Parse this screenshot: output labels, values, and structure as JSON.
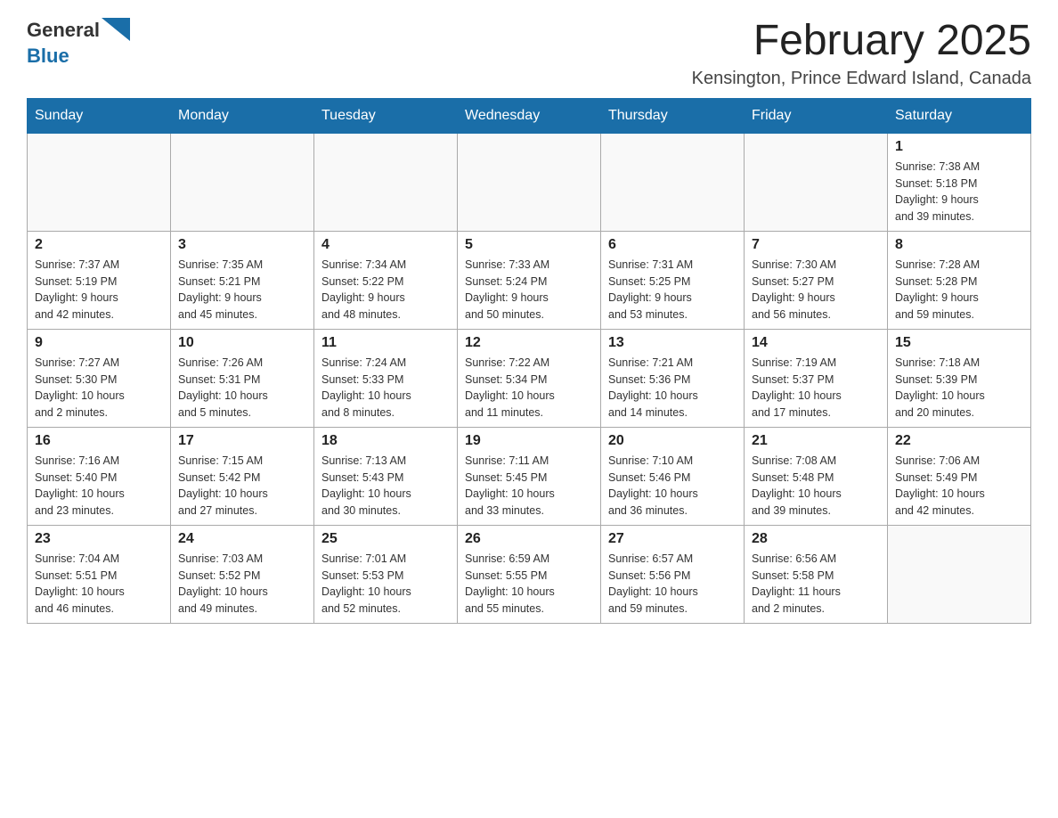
{
  "header": {
    "logo_general": "General",
    "logo_blue": "Blue",
    "month_title": "February 2025",
    "location": "Kensington, Prince Edward Island, Canada"
  },
  "days_of_week": [
    "Sunday",
    "Monday",
    "Tuesday",
    "Wednesday",
    "Thursday",
    "Friday",
    "Saturday"
  ],
  "weeks": [
    [
      {
        "day": "",
        "info": ""
      },
      {
        "day": "",
        "info": ""
      },
      {
        "day": "",
        "info": ""
      },
      {
        "day": "",
        "info": ""
      },
      {
        "day": "",
        "info": ""
      },
      {
        "day": "",
        "info": ""
      },
      {
        "day": "1",
        "info": "Sunrise: 7:38 AM\nSunset: 5:18 PM\nDaylight: 9 hours\nand 39 minutes."
      }
    ],
    [
      {
        "day": "2",
        "info": "Sunrise: 7:37 AM\nSunset: 5:19 PM\nDaylight: 9 hours\nand 42 minutes."
      },
      {
        "day": "3",
        "info": "Sunrise: 7:35 AM\nSunset: 5:21 PM\nDaylight: 9 hours\nand 45 minutes."
      },
      {
        "day": "4",
        "info": "Sunrise: 7:34 AM\nSunset: 5:22 PM\nDaylight: 9 hours\nand 48 minutes."
      },
      {
        "day": "5",
        "info": "Sunrise: 7:33 AM\nSunset: 5:24 PM\nDaylight: 9 hours\nand 50 minutes."
      },
      {
        "day": "6",
        "info": "Sunrise: 7:31 AM\nSunset: 5:25 PM\nDaylight: 9 hours\nand 53 minutes."
      },
      {
        "day": "7",
        "info": "Sunrise: 7:30 AM\nSunset: 5:27 PM\nDaylight: 9 hours\nand 56 minutes."
      },
      {
        "day": "8",
        "info": "Sunrise: 7:28 AM\nSunset: 5:28 PM\nDaylight: 9 hours\nand 59 minutes."
      }
    ],
    [
      {
        "day": "9",
        "info": "Sunrise: 7:27 AM\nSunset: 5:30 PM\nDaylight: 10 hours\nand 2 minutes."
      },
      {
        "day": "10",
        "info": "Sunrise: 7:26 AM\nSunset: 5:31 PM\nDaylight: 10 hours\nand 5 minutes."
      },
      {
        "day": "11",
        "info": "Sunrise: 7:24 AM\nSunset: 5:33 PM\nDaylight: 10 hours\nand 8 minutes."
      },
      {
        "day": "12",
        "info": "Sunrise: 7:22 AM\nSunset: 5:34 PM\nDaylight: 10 hours\nand 11 minutes."
      },
      {
        "day": "13",
        "info": "Sunrise: 7:21 AM\nSunset: 5:36 PM\nDaylight: 10 hours\nand 14 minutes."
      },
      {
        "day": "14",
        "info": "Sunrise: 7:19 AM\nSunset: 5:37 PM\nDaylight: 10 hours\nand 17 minutes."
      },
      {
        "day": "15",
        "info": "Sunrise: 7:18 AM\nSunset: 5:39 PM\nDaylight: 10 hours\nand 20 minutes."
      }
    ],
    [
      {
        "day": "16",
        "info": "Sunrise: 7:16 AM\nSunset: 5:40 PM\nDaylight: 10 hours\nand 23 minutes."
      },
      {
        "day": "17",
        "info": "Sunrise: 7:15 AM\nSunset: 5:42 PM\nDaylight: 10 hours\nand 27 minutes."
      },
      {
        "day": "18",
        "info": "Sunrise: 7:13 AM\nSunset: 5:43 PM\nDaylight: 10 hours\nand 30 minutes."
      },
      {
        "day": "19",
        "info": "Sunrise: 7:11 AM\nSunset: 5:45 PM\nDaylight: 10 hours\nand 33 minutes."
      },
      {
        "day": "20",
        "info": "Sunrise: 7:10 AM\nSunset: 5:46 PM\nDaylight: 10 hours\nand 36 minutes."
      },
      {
        "day": "21",
        "info": "Sunrise: 7:08 AM\nSunset: 5:48 PM\nDaylight: 10 hours\nand 39 minutes."
      },
      {
        "day": "22",
        "info": "Sunrise: 7:06 AM\nSunset: 5:49 PM\nDaylight: 10 hours\nand 42 minutes."
      }
    ],
    [
      {
        "day": "23",
        "info": "Sunrise: 7:04 AM\nSunset: 5:51 PM\nDaylight: 10 hours\nand 46 minutes."
      },
      {
        "day": "24",
        "info": "Sunrise: 7:03 AM\nSunset: 5:52 PM\nDaylight: 10 hours\nand 49 minutes."
      },
      {
        "day": "25",
        "info": "Sunrise: 7:01 AM\nSunset: 5:53 PM\nDaylight: 10 hours\nand 52 minutes."
      },
      {
        "day": "26",
        "info": "Sunrise: 6:59 AM\nSunset: 5:55 PM\nDaylight: 10 hours\nand 55 minutes."
      },
      {
        "day": "27",
        "info": "Sunrise: 6:57 AM\nSunset: 5:56 PM\nDaylight: 10 hours\nand 59 minutes."
      },
      {
        "day": "28",
        "info": "Sunrise: 6:56 AM\nSunset: 5:58 PM\nDaylight: 11 hours\nand 2 minutes."
      },
      {
        "day": "",
        "info": ""
      }
    ]
  ]
}
